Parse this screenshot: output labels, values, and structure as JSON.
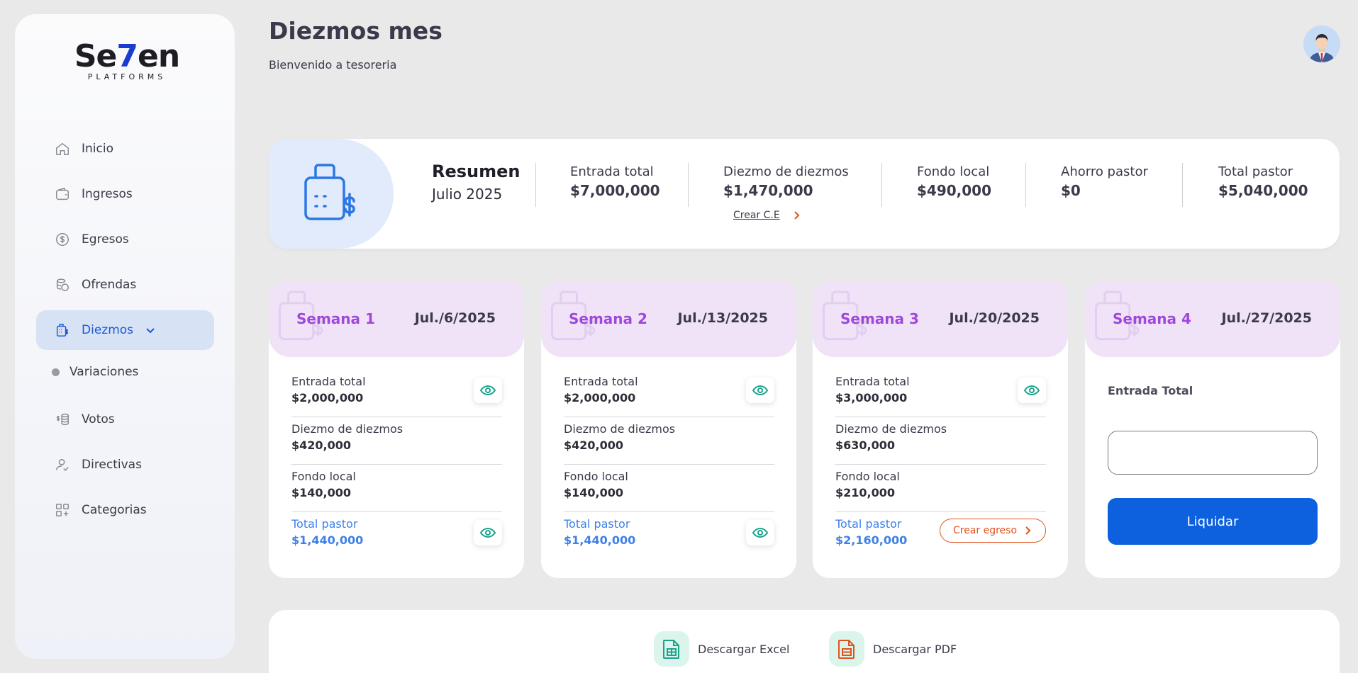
{
  "logo": {
    "brand_main_pre": "Se",
    "brand_main_v": "7",
    "brand_main_post": "en",
    "brand_sub": "PLATFORMS"
  },
  "sidebar": {
    "items": [
      {
        "label": "Inicio",
        "icon": "home-icon"
      },
      {
        "label": "Ingresos",
        "icon": "wallet-icon"
      },
      {
        "label": "Egresos",
        "icon": "dollar-circle-icon"
      },
      {
        "label": "Ofrendas",
        "icon": "coins-icon"
      },
      {
        "label": "Diezmos",
        "icon": "calculator-dollar-icon",
        "active": true
      },
      {
        "label": "Votos",
        "icon": "money-icon"
      },
      {
        "label": "Directivas",
        "icon": "user-check-icon"
      },
      {
        "label": "Categorias",
        "icon": "grid-plus-icon"
      }
    ],
    "sub_item": "Variaciones"
  },
  "header": {
    "title": "Diezmos mes",
    "subtitle": "Bienvenido a tesoreria"
  },
  "summary": {
    "title": "Resumen",
    "period": "Julio 2025",
    "stats": [
      {
        "label": "Entrada total",
        "value": "$7,000,000"
      },
      {
        "label": "Diezmo de diezmos",
        "value": "$1,470,000"
      },
      {
        "label": "Fondo local",
        "value": "$490,000"
      },
      {
        "label": "Ahorro pastor",
        "value": "$0"
      },
      {
        "label": "Total pastor",
        "value": "$5,040,000"
      }
    ],
    "crear_ce": "Crear C.E"
  },
  "weeks": [
    {
      "name": "Semana 1",
      "date": "Jul./6/2025",
      "rows": [
        {
          "label": "Entrada total",
          "value": "$2,000,000"
        },
        {
          "label": "Diezmo de diezmos",
          "value": "$420,000"
        },
        {
          "label": "Fondo local",
          "value": "$140,000"
        },
        {
          "label": "Total pastor",
          "value": "$1,440,000"
        }
      ]
    },
    {
      "name": "Semana 2",
      "date": "Jul./13/2025",
      "rows": [
        {
          "label": "Entrada total",
          "value": "$2,000,000"
        },
        {
          "label": "Diezmo de diezmos",
          "value": "$420,000"
        },
        {
          "label": "Fondo local",
          "value": "$140,000"
        },
        {
          "label": "Total pastor",
          "value": "$1,440,000"
        }
      ]
    },
    {
      "name": "Semana 3",
      "date": "Jul./20/2025",
      "rows": [
        {
          "label": "Entrada total",
          "value": "$3,000,000"
        },
        {
          "label": "Diezmo de diezmos",
          "value": "$630,000"
        },
        {
          "label": "Fondo local",
          "value": "$210,000"
        },
        {
          "label": "Total pastor",
          "value": "$2,160,000"
        }
      ],
      "crear_egreso": "Crear egreso"
    },
    {
      "name": "Semana 4",
      "date": "Jul./27/2025",
      "input_label": "Entrada Total",
      "input_value": "",
      "button": "Liquidar"
    }
  ],
  "downloads": {
    "excel": "Descargar Excel",
    "pdf": "Descargar PDF"
  },
  "colors": {
    "accent": "#0d60de",
    "purple": "#a047dc",
    "teal": "#1aa38a",
    "orange": "#e0531e",
    "blue_text": "#3f80e8"
  }
}
